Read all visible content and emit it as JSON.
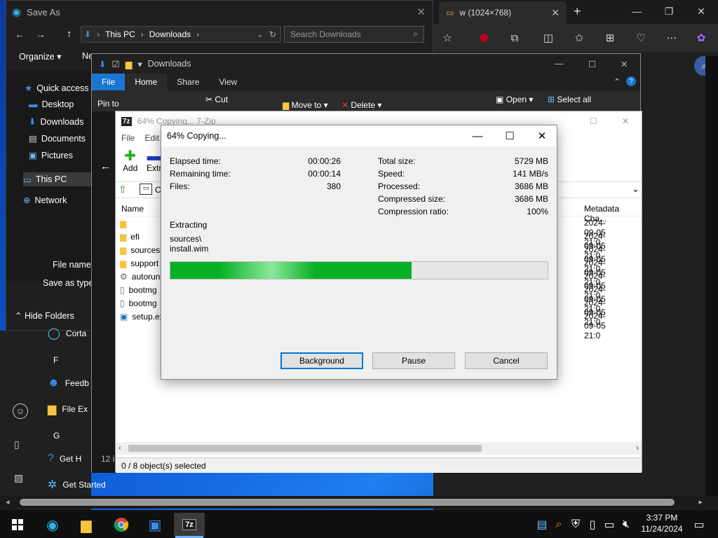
{
  "edge": {
    "tab_title": "w (1024×768)"
  },
  "saveas": {
    "title": "Save As",
    "path": [
      "This PC",
      "Downloads"
    ],
    "search_placeholder": "Search Downloads",
    "organize": "Organize",
    "new_folder": "Ne",
    "nav": [
      "Quick access",
      "Desktop",
      "Downloads",
      "Documents",
      "Pictures",
      "This PC",
      "Network"
    ],
    "file_name_label": "File name:",
    "save_as_type_label": "Save as type:",
    "hide_folders": "Hide Folders"
  },
  "explorer": {
    "title": "Downloads",
    "tabs": [
      "File",
      "Home",
      "Share",
      "View"
    ],
    "ribbon": {
      "pin": "Pin to",
      "cut": "Cut",
      "move_to": "Move to",
      "delete": "Delete",
      "open": "Open",
      "select_all": "Select all"
    }
  },
  "sevenzip": {
    "title": "64% Copying... 7-Zip",
    "menu": [
      "File",
      "Edit"
    ],
    "toolbar": [
      "Add",
      "Extr"
    ],
    "path_prefix": "C",
    "columns": {
      "name": "Name",
      "metadata": "Metadata Cha..."
    },
    "rows": [
      {
        "name": "",
        "date": "2024-09-05 21:0",
        "icon": "folder"
      },
      {
        "name": "efi",
        "date": "2024-09-05 21:0",
        "icon": "folder"
      },
      {
        "name": "sources",
        "date": "2024-09-05 21:0",
        "icon": "folder"
      },
      {
        "name": "support",
        "date": "2024-09-05 21:0",
        "icon": "folder"
      },
      {
        "name": "autorun",
        "date": "2024-09-05 21:0",
        "icon": "gear"
      },
      {
        "name": "bootmg",
        "date": "2024-09-05 21:0",
        "icon": "file"
      },
      {
        "name": "bootmg",
        "date": "2024-09-05 21:0",
        "icon": "file"
      },
      {
        "name": "setup.ex",
        "date": "2024-09-05 21:0",
        "icon": "setup"
      }
    ],
    "status": "0 / 8 object(s) selected",
    "status_left": "12 i"
  },
  "copy": {
    "title": "64% Copying...",
    "elapsed_label": "Elapsed time:",
    "elapsed": "00:00:26",
    "remaining_label": "Remaining time:",
    "remaining": "00:00:14",
    "files_label": "Files:",
    "files": "380",
    "total_label": "Total size:",
    "total": "5729 MB",
    "speed_label": "Speed:",
    "speed": "141 MB/s",
    "processed_label": "Processed:",
    "processed": "3686 MB",
    "compressed_label": "Compressed size:",
    "compressed": "3686 MB",
    "ratio_label": "Compression ratio:",
    "ratio": "100%",
    "action": "Extracting",
    "file_path_1": "sources\\",
    "file_path_2": "install.wim",
    "progress": 0.64,
    "buttons": {
      "background": "Background",
      "pause": "Pause",
      "cancel": "Cancel"
    }
  },
  "start": {
    "items": [
      "Corta",
      "F",
      "Feedb",
      "File Ex",
      "G",
      "Get H",
      "Get Started"
    ]
  },
  "taskbar": {
    "time": "3:37 PM",
    "date": "11/24/2024"
  }
}
